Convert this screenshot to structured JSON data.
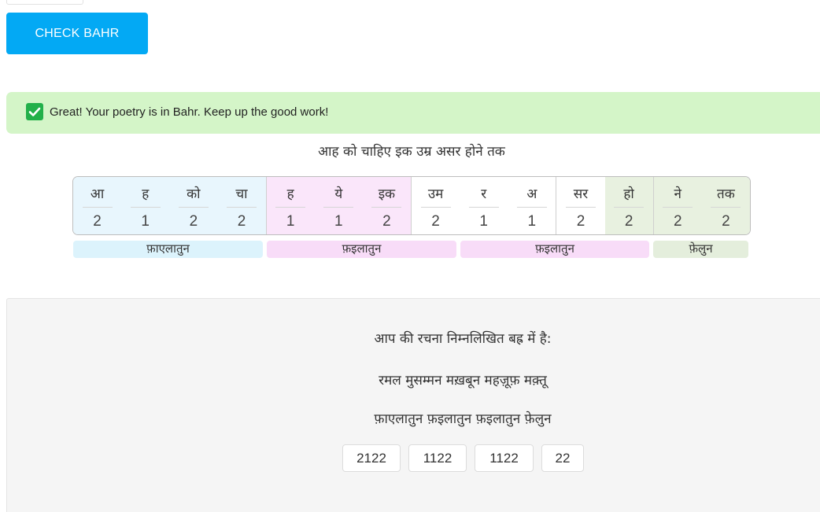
{
  "check_button": {
    "label": "CHECK BAHR"
  },
  "alert": {
    "message": "Great! Your poetry is in Bahr. Keep up the good work!",
    "icon": "check-square-icon",
    "icon_color": "#22b04a",
    "background": "#d4f5c8"
  },
  "verse": {
    "text": "आह को चाहिए इक उम्र असर होने तक"
  },
  "scansion": {
    "syllables": [
      {
        "syllable": "आ",
        "weight": "2"
      },
      {
        "syllable": "ह",
        "weight": "1"
      },
      {
        "syllable": "को",
        "weight": "2"
      },
      {
        "syllable": "चा",
        "weight": "2"
      },
      {
        "syllable": "ह",
        "weight": "1"
      },
      {
        "syllable": "ये",
        "weight": "1"
      },
      {
        "syllable": "इक",
        "weight": "2"
      },
      {
        "syllable": "उम",
        "weight": "2"
      },
      {
        "syllable": "र",
        "weight": "1"
      },
      {
        "syllable": "अ",
        "weight": "1"
      },
      {
        "syllable": "सर",
        "weight": "2"
      },
      {
        "syllable": "हो",
        "weight": "2"
      },
      {
        "syllable": "ने",
        "weight": "2"
      },
      {
        "syllable": "तक",
        "weight": "2"
      }
    ],
    "feet": [
      {
        "name": "फ़ाएलातुन",
        "color": "#dcf3fc"
      },
      {
        "name": "फ़इलातुन",
        "color": "#f8dcf8"
      },
      {
        "name": "फ़इलातुन",
        "color": "#f8dcf8"
      },
      {
        "name": "फ़ेलुन",
        "color": "#e4eedc"
      }
    ]
  },
  "result": {
    "heading": "आप की रचना निम्नलिखित बह्र में है:",
    "bahr_name": "रमल मुसम्मन मख़बून महज़ूफ़ मक़्तू",
    "arkan": "फ़ाएलातुन फ़इलातुन फ़इलातुन फ़ेलुन",
    "codes": [
      "2122",
      "1122",
      "1122",
      "22"
    ]
  }
}
